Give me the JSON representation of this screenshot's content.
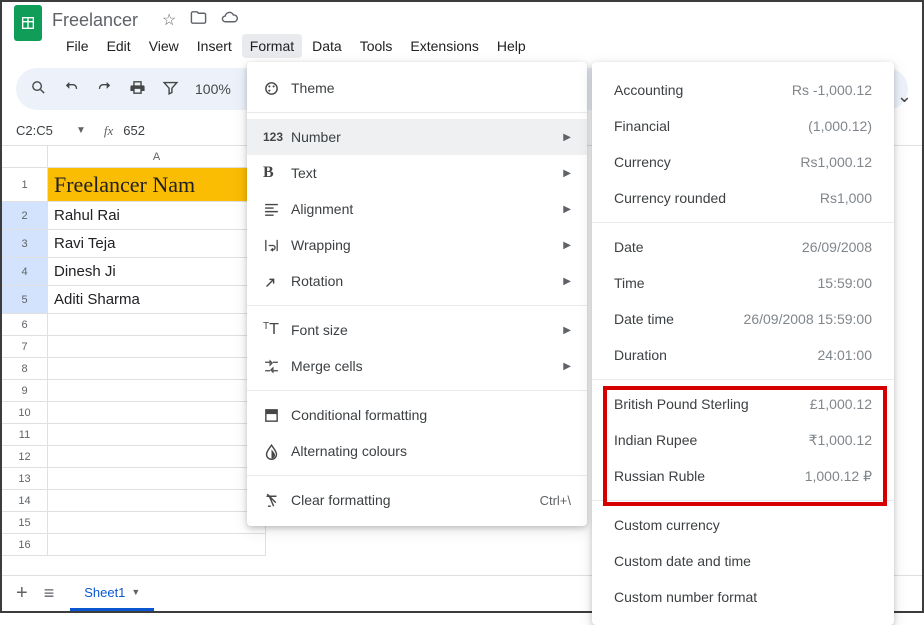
{
  "doc": {
    "title": "Freelancer"
  },
  "menus": [
    "File",
    "Edit",
    "View",
    "Insert",
    "Format",
    "Data",
    "Tools",
    "Extensions",
    "Help"
  ],
  "active_menu": "Format",
  "toolbar": {
    "zoom": "100%"
  },
  "namebox": {
    "ref": "C2:C5",
    "formula_value": "652"
  },
  "columns": [
    "A"
  ],
  "rows": [
    {
      "n": "1",
      "cells": [
        "Freelancer Nam"
      ],
      "header": true
    },
    {
      "n": "2",
      "cells": [
        "Rahul Rai"
      ],
      "sel": true
    },
    {
      "n": "3",
      "cells": [
        "Ravi Teja"
      ],
      "sel": true
    },
    {
      "n": "4",
      "cells": [
        "Dinesh Ji"
      ],
      "sel": true
    },
    {
      "n": "5",
      "cells": [
        "Aditi Sharma"
      ],
      "sel": true
    },
    {
      "n": "6",
      "cells": [
        ""
      ]
    },
    {
      "n": "7",
      "cells": [
        ""
      ]
    },
    {
      "n": "8",
      "cells": [
        ""
      ]
    },
    {
      "n": "9",
      "cells": [
        ""
      ]
    },
    {
      "n": "10",
      "cells": [
        ""
      ]
    },
    {
      "n": "11",
      "cells": [
        ""
      ]
    },
    {
      "n": "12",
      "cells": [
        ""
      ]
    },
    {
      "n": "13",
      "cells": [
        ""
      ]
    },
    {
      "n": "14",
      "cells": [
        ""
      ]
    },
    {
      "n": "15",
      "cells": [
        ""
      ]
    },
    {
      "n": "16",
      "cells": [
        ""
      ]
    }
  ],
  "format_menu": {
    "items": [
      {
        "icon": "theme",
        "label": "Theme"
      },
      {
        "sep": true
      },
      {
        "icon": "number",
        "label": "Number",
        "arrow": true,
        "active": true
      },
      {
        "icon": "bold",
        "label": "Text",
        "arrow": true
      },
      {
        "icon": "align",
        "label": "Alignment",
        "arrow": true
      },
      {
        "icon": "wrap",
        "label": "Wrapping",
        "arrow": true
      },
      {
        "icon": "rotate",
        "label": "Rotation",
        "arrow": true
      },
      {
        "sep": true
      },
      {
        "icon": "fontsize",
        "label": "Font size",
        "arrow": true
      },
      {
        "icon": "merge",
        "label": "Merge cells",
        "arrow": true
      },
      {
        "sep": true
      },
      {
        "icon": "cond",
        "label": "Conditional formatting"
      },
      {
        "icon": "alt",
        "label": "Alternating colours"
      },
      {
        "sep": true
      },
      {
        "icon": "clear",
        "label": "Clear formatting",
        "shortcut": "Ctrl+\\"
      }
    ]
  },
  "number_menu": {
    "items": [
      {
        "label": "Accounting",
        "example": "Rs -1,000.12"
      },
      {
        "label": "Financial",
        "example": "(1,000.12)"
      },
      {
        "label": "Currency",
        "example": "Rs1,000.12"
      },
      {
        "label": "Currency rounded",
        "example": "Rs1,000"
      },
      {
        "sep": true
      },
      {
        "label": "Date",
        "example": "26/09/2008"
      },
      {
        "label": "Time",
        "example": "15:59:00"
      },
      {
        "label": "Date time",
        "example": "26/09/2008 15:59:00"
      },
      {
        "label": "Duration",
        "example": "24:01:00"
      },
      {
        "sep": true
      },
      {
        "label": "British Pound Sterling",
        "example": "£1,000.12"
      },
      {
        "label": "Indian Rupee",
        "example": "₹1,000.12"
      },
      {
        "label": "Russian Ruble",
        "example": "1,000.12 ₽"
      },
      {
        "sep": true
      },
      {
        "label": "Custom currency"
      },
      {
        "label": "Custom date and time"
      },
      {
        "label": "Custom number format"
      }
    ]
  },
  "sheets": {
    "active": "Sheet1"
  }
}
